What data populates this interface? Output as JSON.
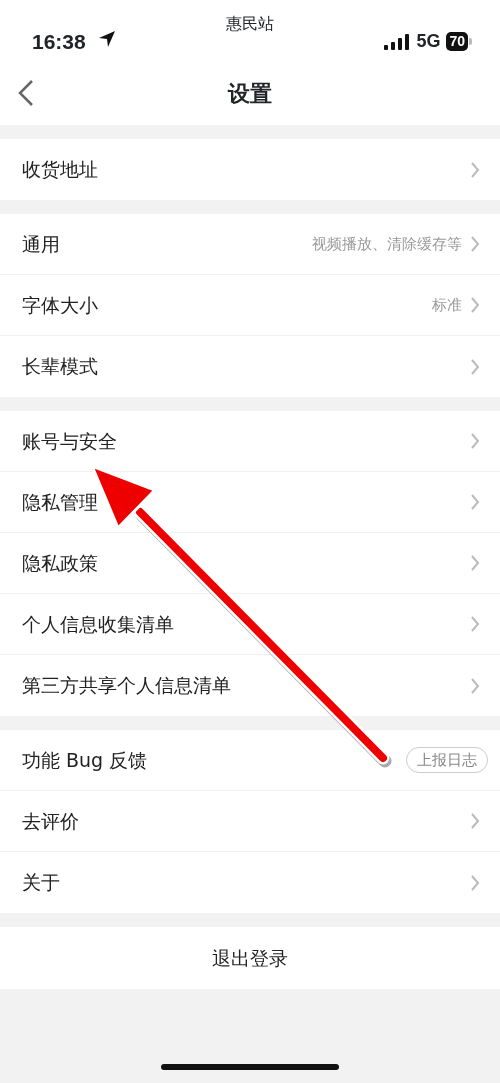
{
  "status_bar": {
    "time": "16:38",
    "carrier": "惠民站",
    "network": "5G",
    "battery": "70"
  },
  "nav": {
    "title": "设置"
  },
  "groups": [
    {
      "items": [
        {
          "label": "收货地址",
          "kind": "chevron"
        }
      ]
    },
    {
      "items": [
        {
          "label": "通用",
          "detail": "视频播放、清除缓存等",
          "kind": "chevron"
        },
        {
          "label": "字体大小",
          "detail": "标准",
          "kind": "chevron"
        },
        {
          "label": "长辈模式",
          "kind": "chevron"
        }
      ]
    },
    {
      "items": [
        {
          "label": "账号与安全",
          "kind": "chevron"
        },
        {
          "label": "隐私管理",
          "kind": "chevron"
        },
        {
          "label": "隐私政策",
          "kind": "chevron"
        },
        {
          "label": "个人信息收集清单",
          "kind": "chevron"
        },
        {
          "label": "第三方共享个人信息清单",
          "kind": "chevron"
        }
      ]
    },
    {
      "items": [
        {
          "label": "功能 Bug 反馈",
          "action": "上报日志",
          "kind": "pill"
        },
        {
          "label": "去评价",
          "kind": "chevron"
        },
        {
          "label": "关于",
          "kind": "chevron"
        }
      ]
    }
  ],
  "logout": "退出登录"
}
